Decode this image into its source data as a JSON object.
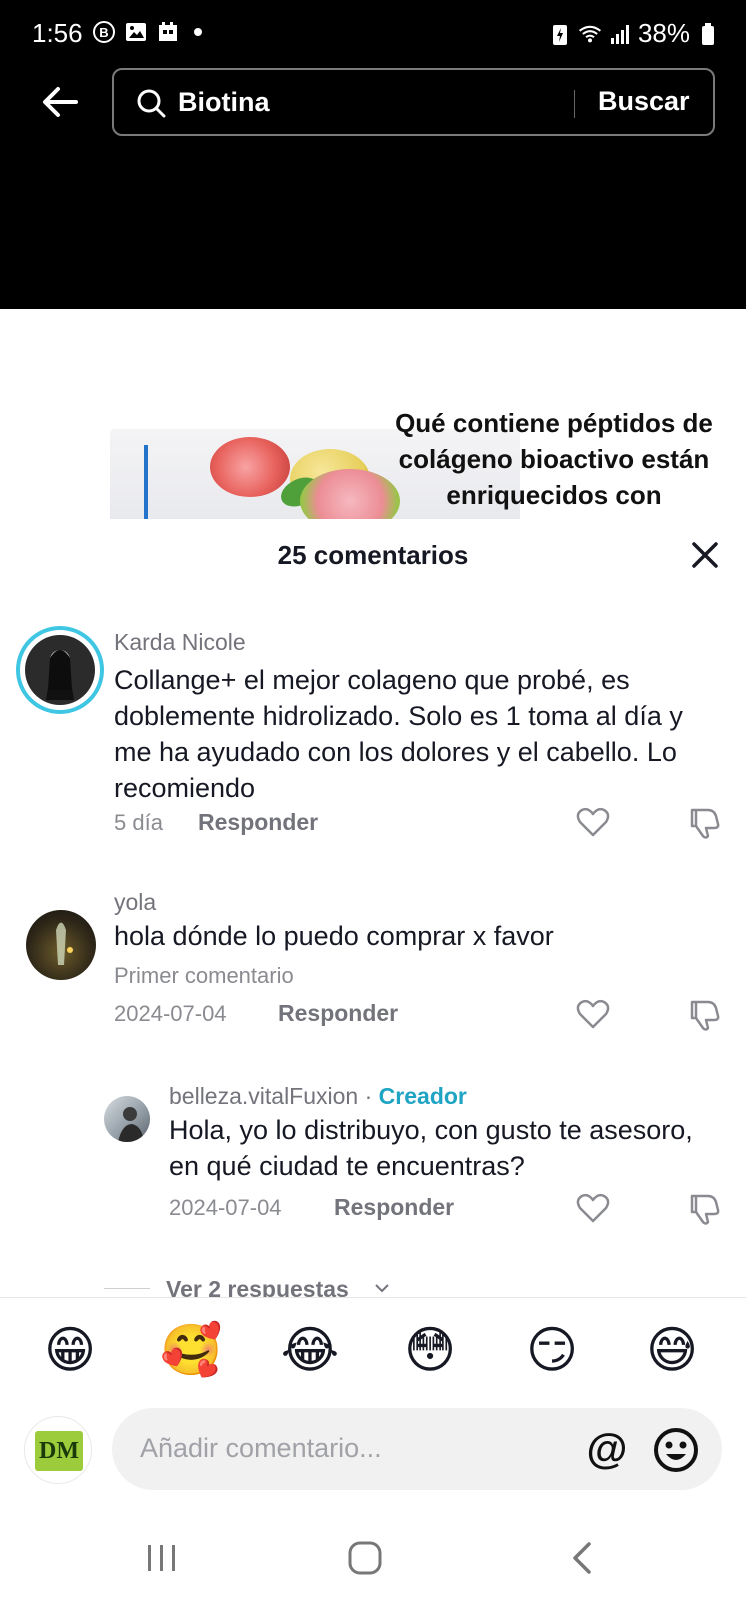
{
  "status_bar": {
    "time": "1:56",
    "battery": "38%"
  },
  "search": {
    "query": "Biotina",
    "button": "Buscar"
  },
  "video": {
    "caption": "Qué contiene péptidos de colágeno bioactivo están enriquecidos con"
  },
  "comments_sheet": {
    "title": "25 comentarios",
    "comments": [
      {
        "user": "Karda Nicole",
        "text": "Collange+ el mejor colageno que probé, es doblemente hidrolizado. Solo es 1 toma al día y me ha ayudado con los dolores y el cabello. Lo recomiendo",
        "time": "5 día",
        "reply": "Responder"
      },
      {
        "user": "yola",
        "text": "hola dónde lo puedo comprar x favor",
        "note": "Primer comentario",
        "time": "2024-07-04",
        "reply": "Responder"
      }
    ],
    "reply_comment": {
      "user": "belleza.vitalFuxion",
      "separator": "·",
      "badge": "Creador",
      "text": "Hola, yo lo distribuyo, con gusto te asesoro, en qué ciudad te encuentras?",
      "time": "2024-07-04",
      "reply": "Responder"
    },
    "view_replies": "Ver 2 respuestas"
  },
  "emoji_bar": [
    "😁",
    "🥰",
    "😂",
    "😳",
    "😏",
    "😅"
  ],
  "composer": {
    "logo_text": "DM",
    "placeholder": "Añadir comentario...",
    "mention": "@"
  }
}
